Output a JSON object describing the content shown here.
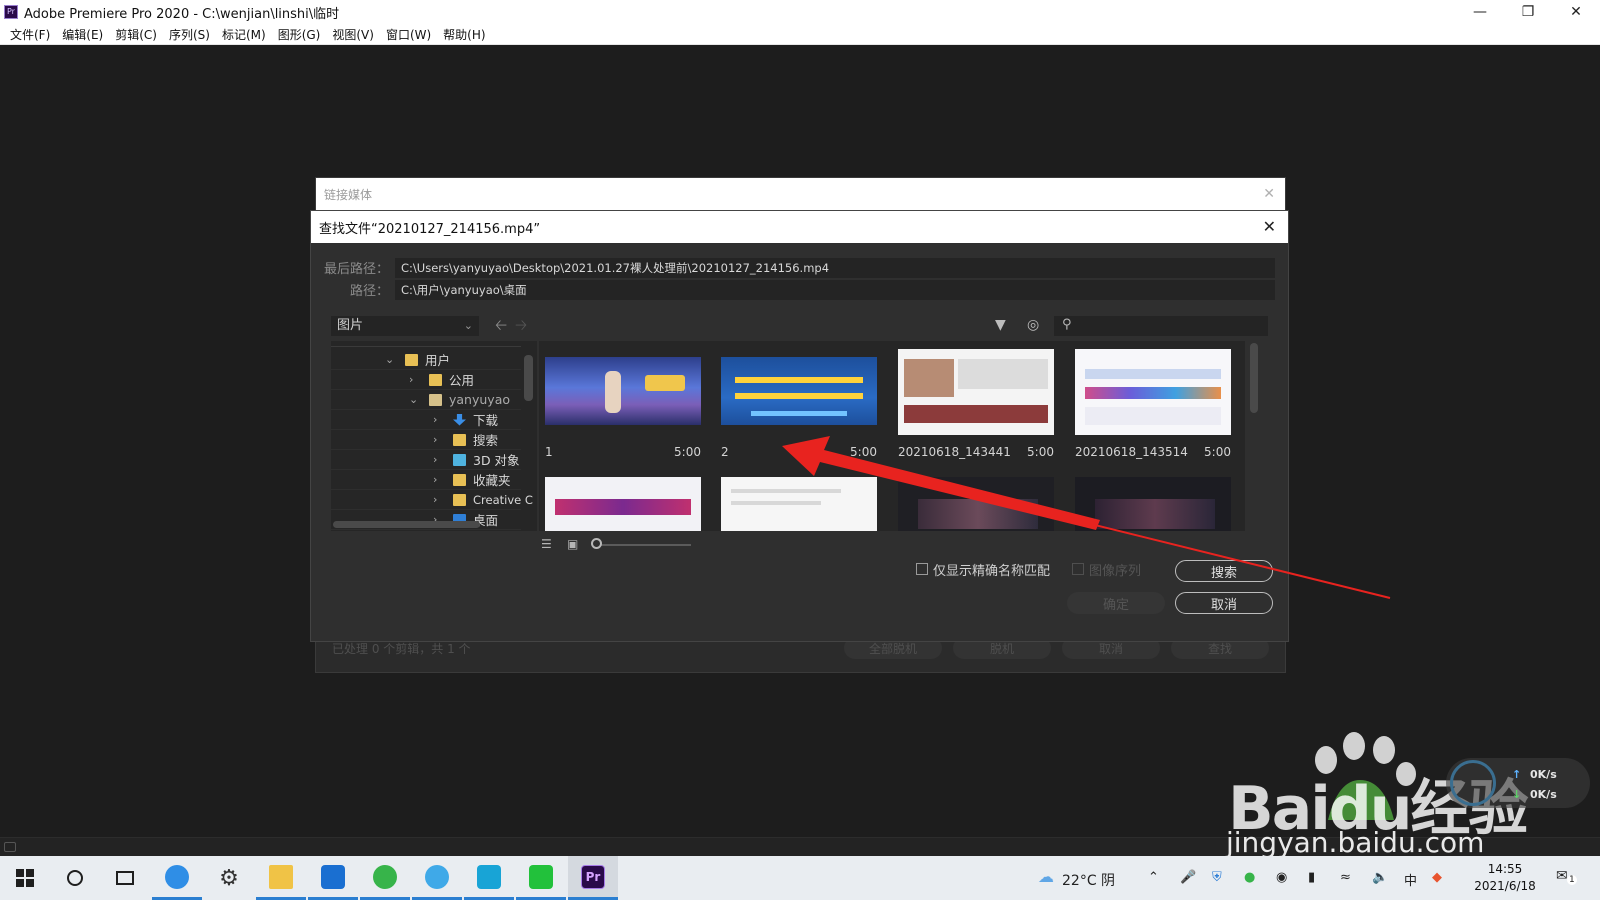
{
  "window": {
    "title": "Adobe Premiere Pro 2020 - C:\\wenjian\\linshi\\临时",
    "app_icon_text": "Pr",
    "controls": {
      "minimize": "—",
      "restore": "❐",
      "close": "✕"
    }
  },
  "menu": [
    "文件(F)",
    "编辑(E)",
    "剪辑(C)",
    "序列(S)",
    "标记(M)",
    "图形(G)",
    "视图(V)",
    "窗口(W)",
    "帮助(H)"
  ],
  "link_media_dialog": {
    "title": "链接媒体",
    "close": "✕",
    "footer_text": "已处理 0 个剪辑，共 1 个",
    "buttons": [
      "全部脱机",
      "脱机",
      "取消",
      "查找"
    ]
  },
  "find_dialog": {
    "title": "查找文件“20210127_214156.mp4”",
    "close": "✕",
    "last_path_label": "最后路径：",
    "last_path_value": "C:\\Users\\yanyuyao\\Desktop\\2021.01.27裸人处理前\\20210127_214156.mp4",
    "path_label": "路径：",
    "path_value": "C:\\用户\\yanyuyao\\桌面",
    "location_select": "图片",
    "tree": [
      {
        "label": "用户",
        "icon": "folder-icon",
        "expanded": true
      },
      {
        "label": "公用",
        "icon": "folder-icon",
        "expanded": false
      },
      {
        "label": "yanyuyao",
        "icon": "user-folder-icon",
        "expanded": true
      },
      {
        "label": "下载",
        "icon": "download-icon",
        "expanded": false
      },
      {
        "label": "搜索",
        "icon": "search-folder-icon",
        "expanded": false
      },
      {
        "label": "3D 对象",
        "icon": "3d-objects-icon",
        "expanded": false
      },
      {
        "label": "收藏夹",
        "icon": "favorites-icon",
        "expanded": false
      },
      {
        "label": "Creative C",
        "icon": "folder-icon",
        "expanded": false
      },
      {
        "label": "桌面",
        "icon": "desktop-icon",
        "expanded": false
      }
    ],
    "thumbnails": [
      {
        "name": "1",
        "duration": "5:00"
      },
      {
        "name": "2",
        "duration": "5:00"
      },
      {
        "name": "20210618_143441",
        "duration": "5:00"
      },
      {
        "name": "20210618_143514",
        "duration": "5:00"
      },
      {
        "name": "",
        "duration": ""
      },
      {
        "name": "",
        "duration": ""
      },
      {
        "name": "",
        "duration": ""
      },
      {
        "name": "",
        "duration": ""
      }
    ],
    "exact_match_label": "仅显示精确名称匹配",
    "image_sequence_label": "图像序列",
    "search_button": "搜索",
    "ok_button": "确定",
    "cancel_button": "取消"
  },
  "watermark": {
    "main": "Baidu经验",
    "sub": "jingyan.baidu.com"
  },
  "net_speed": {
    "up": "0K/s",
    "down": "0K/s"
  },
  "taskbar": {
    "weather": "22°C 阴",
    "ime": "中",
    "time": "14:55",
    "date": "2021/6/18",
    "notification_count": "1",
    "apps": [
      "start-icon",
      "cortana-icon",
      "task-view-icon",
      "browser-icon",
      "settings-icon",
      "file-explorer-icon",
      "mail-icon",
      "wechat-icon",
      "app-icon",
      "store-icon",
      "iqiyi-icon",
      "premiere-icon"
    ]
  },
  "colors": {
    "workspace": "#1d1d1d",
    "dialog": "#2f2f2f",
    "accent_arrow": "#e8231f",
    "taskbar": "#e9edf1"
  }
}
